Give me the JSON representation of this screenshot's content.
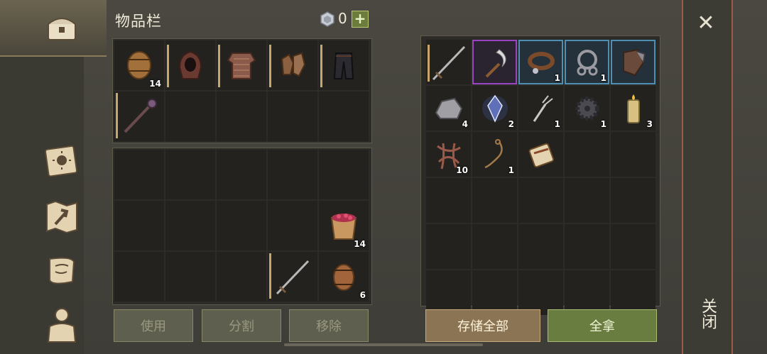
{
  "header": {
    "title": "物品栏",
    "gem_count": "0",
    "plus": "+"
  },
  "sidebar": {
    "items": [
      {
        "name": "chest-icon"
      },
      {
        "name": "journal-icon"
      },
      {
        "name": "map-icon"
      },
      {
        "name": "scroll-icon"
      },
      {
        "name": "character-icon"
      }
    ]
  },
  "equipment": [
    {
      "item": "barrel",
      "qty": "14"
    },
    {
      "item": "hood",
      "qty": ""
    },
    {
      "item": "chainmail",
      "qty": ""
    },
    {
      "item": "gloves",
      "qty": ""
    },
    {
      "item": "pants",
      "qty": ""
    },
    {
      "item": "mace",
      "qty": ""
    }
  ],
  "backpack": [
    {
      "slot": 9,
      "item": "berries-bucket",
      "qty": "14"
    },
    {
      "slot": 13,
      "item": "sword",
      "qty": ""
    },
    {
      "slot": 14,
      "item": "keg",
      "qty": "6"
    }
  ],
  "storage": [
    {
      "slot": 0,
      "item": "sword",
      "qty": ""
    },
    {
      "slot": 1,
      "item": "sickle",
      "qty": ""
    },
    {
      "slot": 2,
      "item": "collar",
      "qty": "1"
    },
    {
      "slot": 3,
      "item": "chain",
      "qty": "1"
    },
    {
      "slot": 4,
      "item": "armor-piece",
      "qty": ""
    },
    {
      "slot": 5,
      "item": "stone",
      "qty": "4"
    },
    {
      "slot": 6,
      "item": "crystal",
      "qty": "2"
    },
    {
      "slot": 7,
      "item": "fork",
      "qty": "1"
    },
    {
      "slot": 8,
      "item": "gear",
      "qty": "1"
    },
    {
      "slot": 9,
      "item": "candle",
      "qty": "3"
    },
    {
      "slot": 10,
      "item": "roots",
      "qty": "10"
    },
    {
      "slot": 11,
      "item": "rope",
      "qty": "1"
    },
    {
      "slot": 12,
      "item": "scroll-bundle",
      "qty": ""
    }
  ],
  "buttons": {
    "use": "使用",
    "split": "分割",
    "remove": "移除",
    "store_all": "存储全部",
    "take_all": "全拿"
  },
  "close": {
    "label": "关闭",
    "x": "✕"
  },
  "colors": {
    "rare": "#9a44c4",
    "uncommon": "#4f8fb4"
  }
}
